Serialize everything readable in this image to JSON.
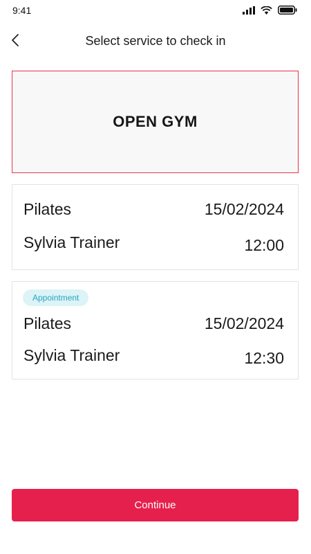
{
  "status_bar": {
    "time": "9:41"
  },
  "header": {
    "title": "Select service to check in"
  },
  "open_gym": {
    "label": "OPEN GYM"
  },
  "services": [
    {
      "name": "Pilates",
      "date": "15/02/2024",
      "trainer": "Sylvia Trainer",
      "time": "12:00"
    },
    {
      "badge": "Appointment",
      "name": "Pilates",
      "date": "15/02/2024",
      "trainer": "Sylvia Trainer",
      "time": "12:30"
    }
  ],
  "continue_label": "Continue",
  "colors": {
    "accent": "#e6204c",
    "badge_bg": "#dcf3f7",
    "badge_text": "#26a6bf"
  },
  "icons": [
    "signal-icon",
    "wifi-icon",
    "battery-icon",
    "back-arrow-icon"
  ]
}
